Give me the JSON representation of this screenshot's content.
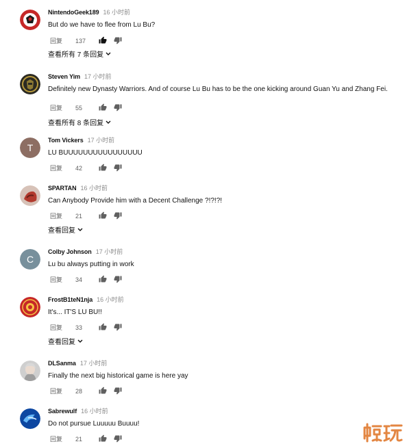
{
  "labels": {
    "reply": "回复"
  },
  "comments": [
    {
      "author": "NintendoGeek189",
      "time": "16 小时前",
      "text": "But do we have to flee from Lu Bu?",
      "likes": "137",
      "liked": true,
      "replies": "查看所有 7 条回复"
    },
    {
      "author": "Steven Yim",
      "time": "17 小时前",
      "text": "Definitely new Dynasty Warriors. And of course Lu Bu has to be the one kicking around Guan Yu and Zhang Fei.",
      "likes": "55",
      "replies": "查看所有 8 条回复"
    },
    {
      "author": "Tom Vickers",
      "time": "17 小时前",
      "text": "LU BUUUUUUUUUUUUUUUU",
      "likes": "42",
      "avatar_letter": "T",
      "avatar_color": "#8d6e63"
    },
    {
      "author": "SPARTAN",
      "time": "16 小时前",
      "text": "Can Anybody Provide him with a Decent Challenge ?!?!?!",
      "likes": "21",
      "replies": "查看回复"
    },
    {
      "author": "Colby Johnson",
      "time": "17 小时前",
      "text": "Lu bu always putting in work",
      "likes": "34",
      "avatar_letter": "C",
      "avatar_color": "#78909c"
    },
    {
      "author": "FrostB1teN1nja",
      "time": "16 小时前",
      "text": "It's... IT'S LU BU!!",
      "likes": "33",
      "replies": "查看回复"
    },
    {
      "author": "DLSanma",
      "time": "17 小时前",
      "text": "Finally the next big historical game is here yay",
      "likes": "28"
    },
    {
      "author": "Sabrewulf",
      "time": "16 小时前",
      "text": "Do not pursue Luuuuu Buuuu!",
      "likes": "21"
    }
  ],
  "watermark": {
    "text": "蜗玩",
    "color": "#e07a2e"
  }
}
